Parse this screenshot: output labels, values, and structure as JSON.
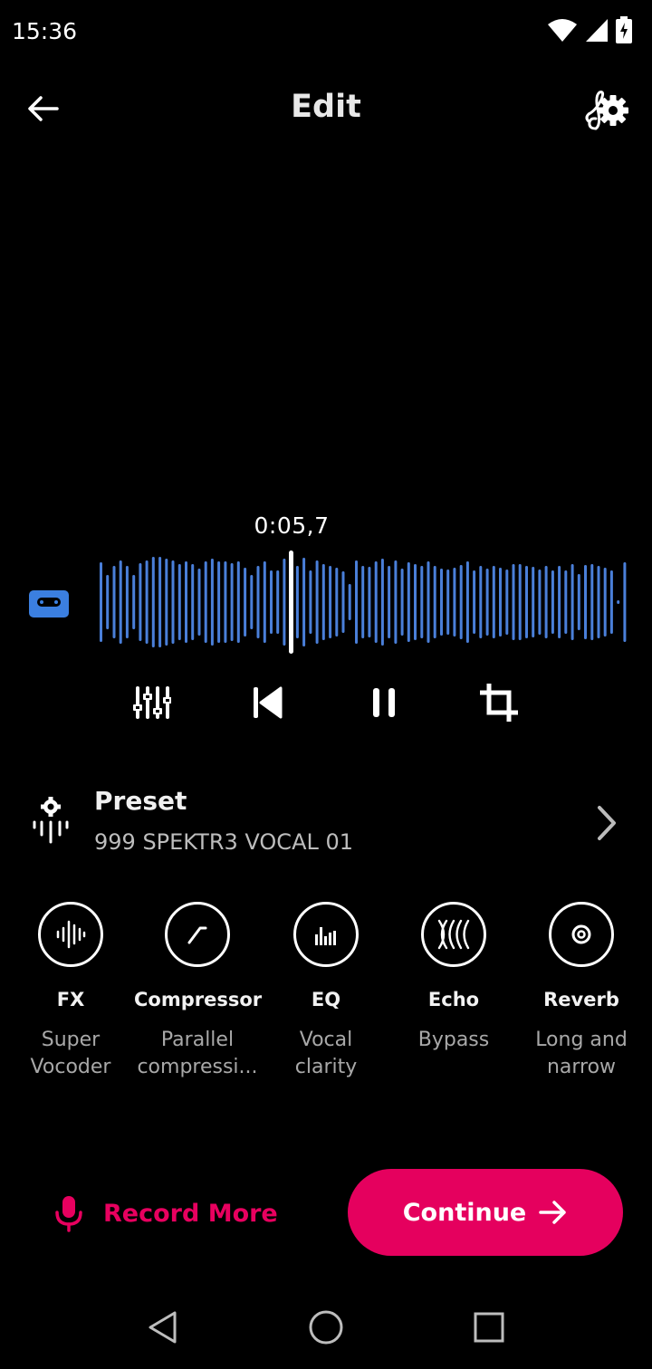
{
  "status_bar": {
    "time": "15:36"
  },
  "header": {
    "title": "Edit"
  },
  "player": {
    "time": "0:05,7"
  },
  "preset": {
    "title": "Preset",
    "value": "999 SPEKTR3 VOCAL 01"
  },
  "effects": [
    {
      "name": "FX",
      "sub": [
        "Super",
        "Vocoder"
      ],
      "icon": "waveform-icon"
    },
    {
      "name": "Compressor",
      "sub": [
        "Parallel",
        "compressi..."
      ],
      "icon": "compressor-curve-icon"
    },
    {
      "name": "EQ",
      "sub": [
        "Vocal",
        "clarity"
      ],
      "icon": "eq-bars-icon"
    },
    {
      "name": "Echo",
      "sub": [
        "Bypass"
      ],
      "icon": "echo-waves-icon"
    },
    {
      "name": "Reverb",
      "sub": [
        "Long and",
        "narrow"
      ],
      "icon": "reverb-rings-icon"
    }
  ],
  "actions": {
    "record_more": "Record More",
    "continue": "Continue"
  },
  "colors": {
    "accent": "#e5005e",
    "waveform": "#4a7fd9",
    "track_icon": "#3b7fe0"
  }
}
